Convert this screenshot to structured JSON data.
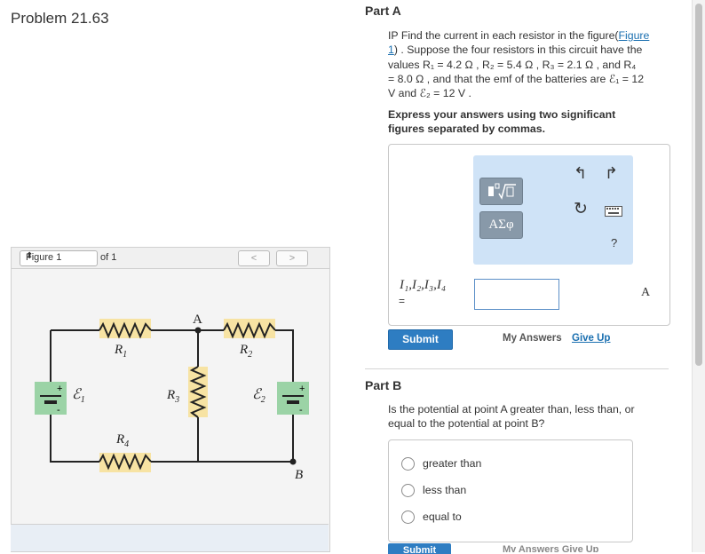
{
  "problem": {
    "title": "Problem 21.63"
  },
  "figure": {
    "selector_value": "Figure 1",
    "of_label": "of 1",
    "prev_label": "<",
    "next_label": ">",
    "labels": {
      "A": "A",
      "B": "B",
      "R1": "R",
      "R1_sub": "1",
      "R2": "R",
      "R2_sub": "2",
      "R3": "R",
      "R3_sub": "3",
      "R4": "R",
      "R4_sub": "4",
      "E1": "ℰ",
      "E1_sub": "1",
      "E2": "ℰ",
      "E2_sub": "2",
      "plus": "+",
      "minus": "-"
    },
    "colors": {
      "resistor_bg": "#f7e3a3",
      "battery_bg": "#9bd3a6",
      "wire": "#222222"
    }
  },
  "part_a": {
    "title": "Part A",
    "question_line1_pre": "IP Find the current in each resistor in the figure(",
    "question_link": "Figure",
    "question_line2_link": "1",
    "question_line2_post": ") . Suppose the four resistors in this circuit have the",
    "question_line3": "values R₁ = 4.2 Ω , R₂ = 5.4 Ω , R₃ = 2.1 Ω , and R₄",
    "question_line4": "= 8.0 Ω , and that the emf of the batteries are ℰ₁ = 12",
    "question_line5": "V and ℰ₂ = 12 V .",
    "instruction": "Express your answers using two significant figures separated by commas.",
    "toolbar": {
      "template_icon": "sqrt-template-icon",
      "greek_label": "ΑΣφ",
      "help_label": "?"
    },
    "variables_label": "I₁,I₂,I₃,I₄",
    "equals": "=",
    "answer_value": "",
    "unit": "A",
    "submit_label": "Submit",
    "my_answers_label": "My Answers",
    "give_up_label": "Give Up"
  },
  "part_b": {
    "title": "Part B",
    "question": "Is the potential at point A greater than, less than, or equal to the potential at point B?",
    "options": [
      "greater than",
      "less than",
      "equal to"
    ],
    "submit_label": "Submit",
    "links_partial": "My Answers  Give Up"
  }
}
